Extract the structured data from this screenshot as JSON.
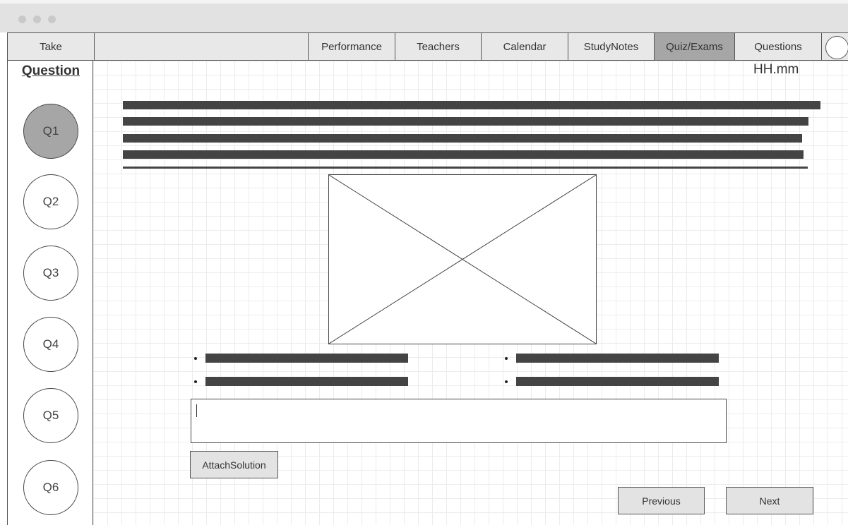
{
  "nav": {
    "take": "Take",
    "tabs": [
      {
        "label": "Performance",
        "active": false
      },
      {
        "label": "Teachers",
        "active": false
      },
      {
        "label": "Calendar",
        "active": false
      },
      {
        "label": "StudyNotes",
        "active": false
      },
      {
        "label": "Quiz/Exams",
        "active": true
      },
      {
        "label": "Questions",
        "active": false
      }
    ]
  },
  "sidebar": {
    "title": "Question",
    "questions": [
      {
        "label": "Q1",
        "active": true
      },
      {
        "label": "Q2",
        "active": false
      },
      {
        "label": "Q3",
        "active": false
      },
      {
        "label": "Q4",
        "active": false
      },
      {
        "label": "Q5",
        "active": false
      },
      {
        "label": "Q6",
        "active": false
      }
    ]
  },
  "main": {
    "timer": "HH.mm",
    "answer_value": "",
    "attach_label": "AttachSolution",
    "previous_label": "Previous",
    "next_label": "Next"
  },
  "colors": {
    "active_fill": "#a6a6a6",
    "text_bar": "#444444",
    "button_fill": "#e3e3e3"
  }
}
